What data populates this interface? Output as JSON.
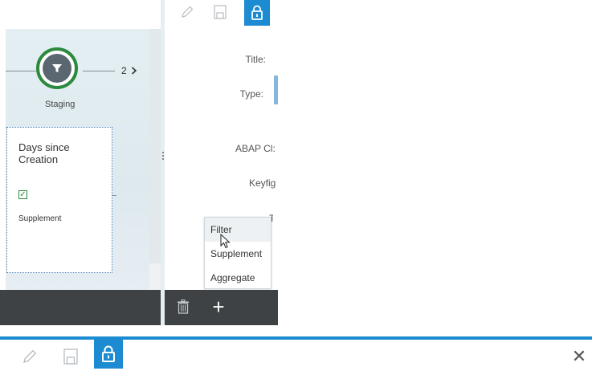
{
  "flow": {
    "stage_count": "2",
    "stage_label": "Staging"
  },
  "node_card": {
    "title": "Days since Creation",
    "checkbox_checked": true,
    "subtitle": "Supplement"
  },
  "form": {
    "title_label": "Title:",
    "type_label": "Type:",
    "abap_label": "ABAP Cl:",
    "keyfig_label": "Keyfig",
    "type2_label": "Ty"
  },
  "type_menu": {
    "items": [
      "Filter",
      "Supplement",
      "Aggregate"
    ],
    "hovered": "Filter"
  },
  "icons": {
    "edit": "pencil-icon",
    "save": "save-icon",
    "lock": "lock-icon",
    "trash": "trash-icon",
    "add": "plus-icon",
    "close": "close-icon",
    "stage": "filter-icon"
  },
  "colors": {
    "accent": "#1c8bd1",
    "stage_ring": "#2c8a3e",
    "dark_bar": "#3e4245"
  },
  "bottom_toolbar": {
    "add_symbol": "+",
    "close_symbol": "✕"
  }
}
